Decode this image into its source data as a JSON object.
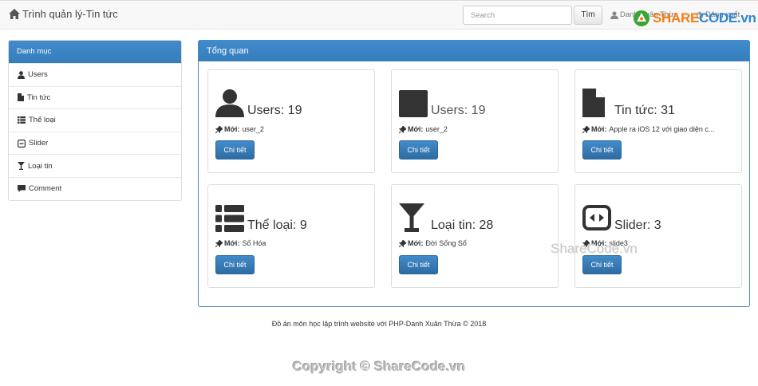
{
  "brand": {
    "title": "Trình quản lý-Tin tức",
    "icon": "home-icon"
  },
  "navbar": {
    "search_placeholder": "Search",
    "search_button": "Tìm",
    "user": "Danh Xuân Thừa",
    "logout": "Đăng xuất"
  },
  "logo": {
    "text_a": "SHARE",
    "text_b": "CODE.vn"
  },
  "sidebar": {
    "header": "Danh mục",
    "items": [
      {
        "label": "Users",
        "icon": "user-icon"
      },
      {
        "label": "Tin tức",
        "icon": "file-icon"
      },
      {
        "label": "Thể loại",
        "icon": "list-icon"
      },
      {
        "label": "Slider",
        "icon": "minus-square-icon"
      },
      {
        "label": "Loại tin",
        "icon": "glass-icon"
      },
      {
        "label": "Comment",
        "icon": "comment-icon"
      }
    ]
  },
  "main": {
    "header": "Tổng quan",
    "latest_label": "Mới:",
    "detail_label": "Chi tiết",
    "cards": [
      {
        "title": "Users: 19",
        "latest": "user_2",
        "icon": "user-icon"
      },
      {
        "title": "Users: 19",
        "latest": "user_2",
        "icon": "user-icon"
      },
      {
        "title": "Tin tức: 31",
        "latest": "Apple ra iOS 12 với giao diện c...",
        "icon": "file-icon"
      },
      {
        "title": "Thể loại: 9",
        "latest": "Số Hóa",
        "icon": "list-icon"
      },
      {
        "title": "Loại tin: 28",
        "latest": "Đời Sống Số",
        "icon": "glass-icon"
      },
      {
        "title": "Slider: 3",
        "latest": "slide3",
        "icon": "slider-icon"
      }
    ]
  },
  "footer": "Đồ án môn học lập trình website với PHP-Danh Xuân Thừa © 2018",
  "copyright": "Copyright © ShareCode.vn",
  "watermark": "ShareCode.vn",
  "colors": {
    "primary": "#428bca",
    "logo_orange": "#f57c14",
    "logo_blue": "#2e86d4"
  }
}
